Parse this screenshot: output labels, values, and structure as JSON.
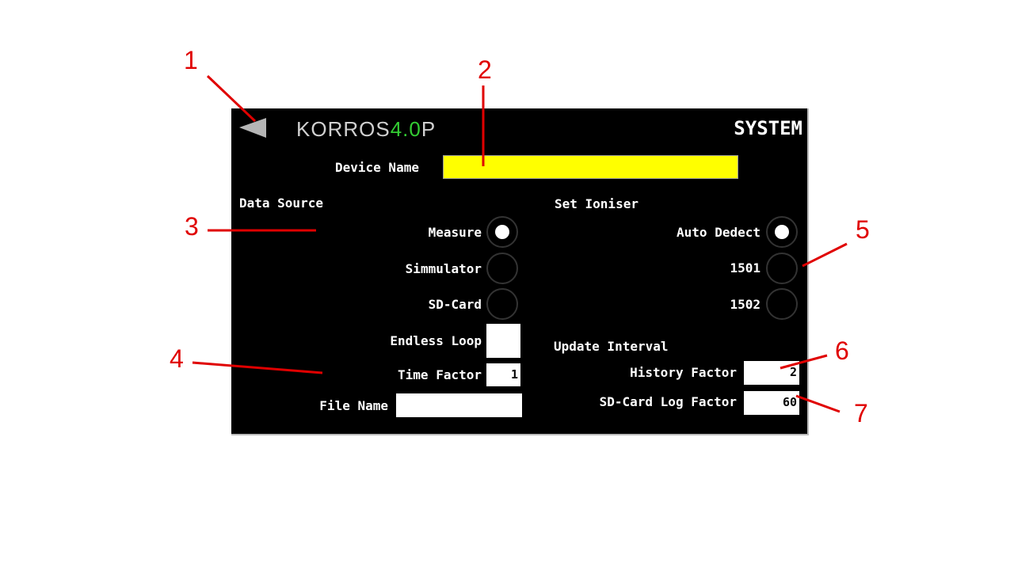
{
  "header": {
    "logo_main": "KORROS",
    "logo_accent": "4.0",
    "logo_tail": "P",
    "title": "SYSTEM",
    "back_icon": "back-triangle-icon"
  },
  "device": {
    "label": "Device Name",
    "value": ""
  },
  "data_source": {
    "heading": "Data Source",
    "options": [
      {
        "label": "Measure",
        "selected": true
      },
      {
        "label": "Simmulator",
        "selected": false
      },
      {
        "label": "SD-Card",
        "selected": false
      }
    ],
    "endless_loop_label": "Endless Loop",
    "time_factor_label": "Time Factor",
    "time_factor_value": "1",
    "file_name_label": "File Name",
    "file_name_value": ""
  },
  "ioniser": {
    "heading": "Set Ioniser",
    "options": [
      {
        "label": "Auto Dedect",
        "selected": true
      },
      {
        "label": "1501",
        "selected": false
      },
      {
        "label": "1502",
        "selected": false
      }
    ]
  },
  "update_interval": {
    "heading": "Update Interval",
    "history_label": "History Factor",
    "history_value": "2",
    "sdlog_label": "SD-Card Log Factor",
    "sdlog_value": "60"
  },
  "annotations": [
    "1",
    "2",
    "3",
    "4",
    "5",
    "6",
    "7"
  ],
  "colors": {
    "accent_yellow": "#ffff00",
    "annotation_red": "#e00000",
    "logo_green": "#33cc33"
  }
}
